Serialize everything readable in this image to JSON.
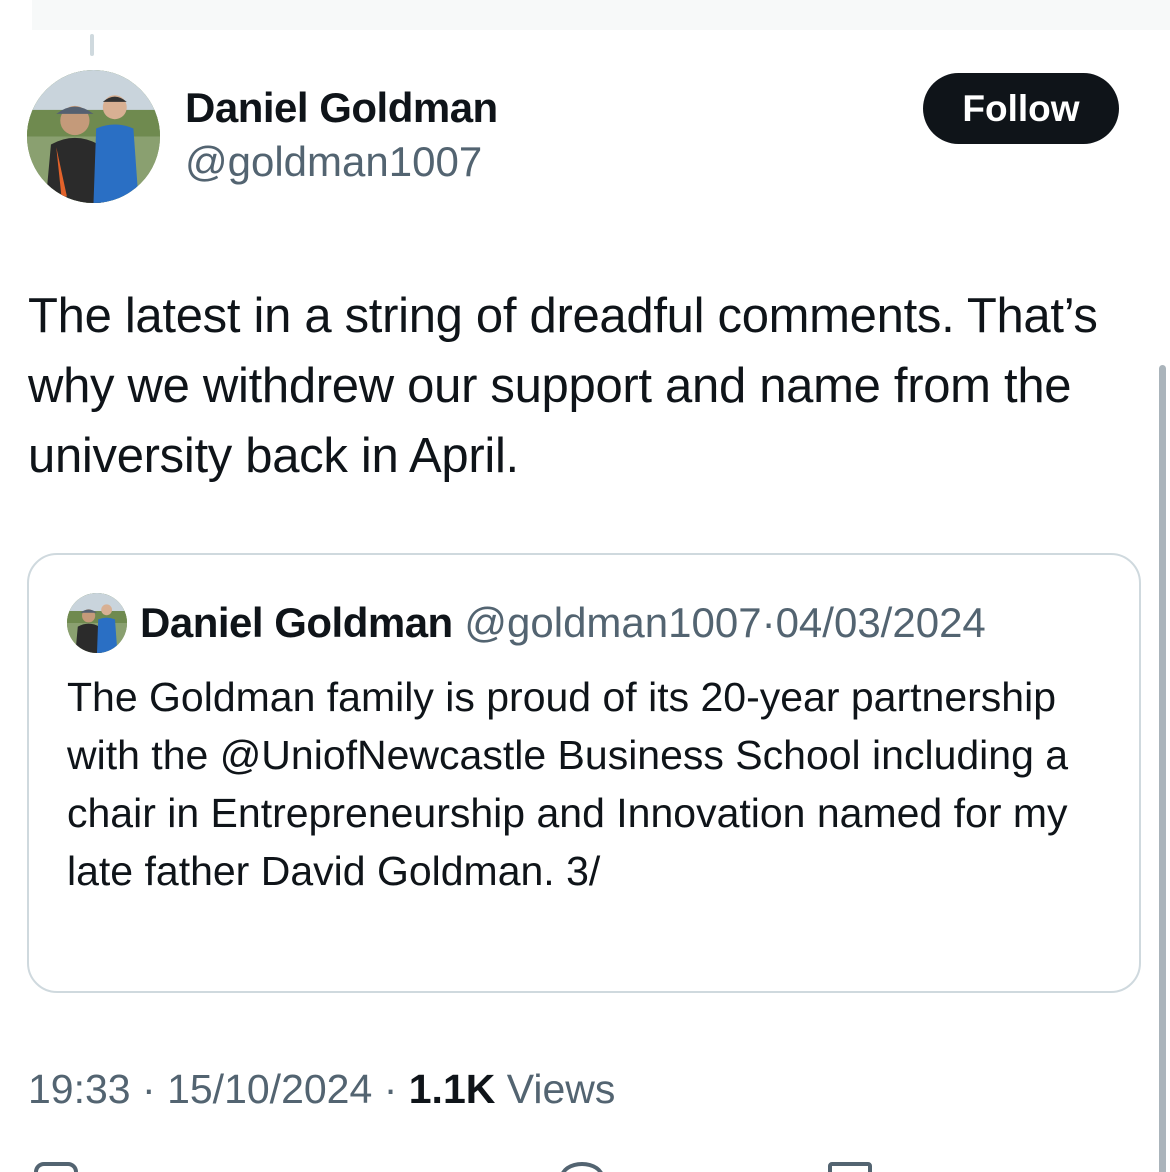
{
  "tweet": {
    "author": {
      "display_name": "Daniel Goldman",
      "handle": "@goldman1007"
    },
    "follow_label": "Follow",
    "text": "The latest in a string of dreadful comments. That’s why we withdrew our support and name from the university back in April.",
    "quoted": {
      "display_name": "Daniel Goldman",
      "handle": "@goldman1007",
      "separator": "·",
      "date": "04/03/2024",
      "text": "The Goldman family is proud of its 20-year partnership with the @UniofNewcastle Business School including a chair in Entrepreneurship and Innovation named for my late father David Goldman. 3/"
    },
    "meta": {
      "time": "19:33",
      "separator": "·",
      "date": "15/10/2024",
      "views_count": "1.1K",
      "views_label": "Views"
    }
  },
  "icons": {
    "avatar": "avatar-photo",
    "actions": [
      "reply-icon",
      "retweet-icon",
      "like-icon",
      "bookmark-icon"
    ]
  },
  "colors": {
    "text_primary": "#0f1419",
    "text_secondary": "#536471",
    "border": "#cfd9de",
    "follow_button_bg": "#0f1419"
  }
}
